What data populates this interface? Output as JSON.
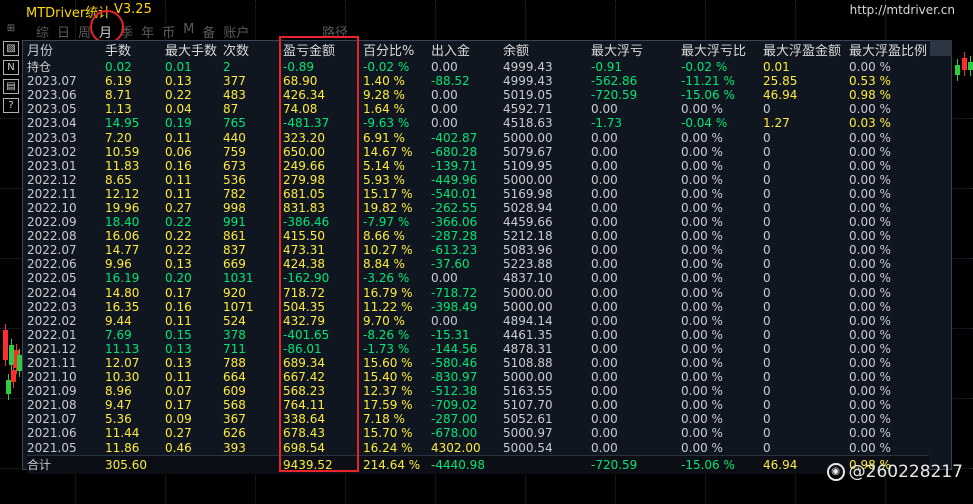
{
  "titlebar": {
    "app": "MTDriver统计",
    "version": "V3.25",
    "site": "http://mtdriver.cn"
  },
  "tools": [
    "⊞",
    "▧",
    "N",
    "▤",
    "?"
  ],
  "tabs": [
    {
      "label": "综",
      "active": false
    },
    {
      "label": "日",
      "active": false
    },
    {
      "label": "周",
      "active": false
    },
    {
      "label": "月",
      "active": true
    },
    {
      "label": "季",
      "active": false
    },
    {
      "label": "年",
      "active": false
    },
    {
      "label": "币",
      "active": false
    },
    {
      "label": "M",
      "active": false
    },
    {
      "label": "备",
      "active": false
    },
    {
      "label": "账户",
      "active": false
    }
  ],
  "tab_extra": "路径",
  "table": {
    "headers": [
      "月份",
      "手数",
      "最大手数",
      "次数",
      "盈亏金额",
      "百分比%",
      "出入金",
      "余额",
      "最大浮亏",
      "最大浮亏比",
      "最大浮盈金额",
      "最大浮盈比例"
    ],
    "rows": [
      [
        "持仓",
        "0.02",
        "0.01",
        "2",
        "-0.89",
        "-0.02 %",
        "0.00",
        "4999.43",
        "-0.91",
        "-0.02 %",
        "0.01",
        "0.00 %"
      ],
      [
        "2023.07",
        "6.19",
        "0.13",
        "377",
        "68.90",
        "1.40 %",
        "-88.52",
        "4999.43",
        "-562.86",
        "-11.21 %",
        "25.85",
        "0.53 %"
      ],
      [
        "2023.06",
        "8.71",
        "0.22",
        "483",
        "426.34",
        "9.28 %",
        "0.00",
        "5019.05",
        "-720.59",
        "-15.06 %",
        "46.94",
        "0.98 %"
      ],
      [
        "2023.05",
        "1.13",
        "0.04",
        "87",
        "74.08",
        "1.64 %",
        "0.00",
        "4592.71",
        "0.00",
        "0.00 %",
        "0",
        "0.00 %"
      ],
      [
        "2023.04",
        "14.95",
        "0.19",
        "765",
        "-481.37",
        "-9.63 %",
        "0.00",
        "4518.63",
        "-1.73",
        "-0.04 %",
        "1.27",
        "0.03 %"
      ],
      [
        "2023.03",
        "7.20",
        "0.11",
        "440",
        "323.20",
        "6.91 %",
        "-402.87",
        "5000.00",
        "0.00",
        "0.00 %",
        "0",
        "0.00 %"
      ],
      [
        "2023.02",
        "10.59",
        "0.06",
        "759",
        "650.00",
        "14.67 %",
        "-680.28",
        "5079.67",
        "0.00",
        "0.00 %",
        "0",
        "0.00 %"
      ],
      [
        "2023.01",
        "11.83",
        "0.16",
        "673",
        "249.66",
        "5.14 %",
        "-139.71",
        "5109.95",
        "0.00",
        "0.00 %",
        "0",
        "0.00 %"
      ],
      [
        "2022.12",
        "8.65",
        "0.11",
        "536",
        "279.98",
        "5.93 %",
        "-449.96",
        "5000.00",
        "0.00",
        "0.00 %",
        "0",
        "0.00 %"
      ],
      [
        "2022.11",
        "12.12",
        "0.11",
        "782",
        "681.05",
        "15.17 %",
        "-540.01",
        "5169.98",
        "0.00",
        "0.00 %",
        "0",
        "0.00 %"
      ],
      [
        "2022.10",
        "19.96",
        "0.27",
        "998",
        "831.83",
        "19.82 %",
        "-262.55",
        "5028.94",
        "0.00",
        "0.00 %",
        "0",
        "0.00 %"
      ],
      [
        "2022.09",
        "18.40",
        "0.22",
        "991",
        "-386.46",
        "-7.97 %",
        "-366.06",
        "4459.66",
        "0.00",
        "0.00 %",
        "0",
        "0.00 %"
      ],
      [
        "2022.08",
        "16.06",
        "0.22",
        "861",
        "415.50",
        "8.66 %",
        "-287.28",
        "5212.18",
        "0.00",
        "0.00 %",
        "0",
        "0.00 %"
      ],
      [
        "2022.07",
        "14.77",
        "0.22",
        "837",
        "473.31",
        "10.27 %",
        "-613.23",
        "5083.96",
        "0.00",
        "0.00 %",
        "0",
        "0.00 %"
      ],
      [
        "2022.06",
        "9.96",
        "0.13",
        "669",
        "424.38",
        "8.84 %",
        "-37.60",
        "5223.88",
        "0.00",
        "0.00 %",
        "0",
        "0.00 %"
      ],
      [
        "2022.05",
        "16.19",
        "0.20",
        "1031",
        "-162.90",
        "-3.26 %",
        "0.00",
        "4837.10",
        "0.00",
        "0.00 %",
        "0",
        "0.00 %"
      ],
      [
        "2022.04",
        "14.80",
        "0.17",
        "920",
        "718.72",
        "16.79 %",
        "-718.72",
        "5000.00",
        "0.00",
        "0.00 %",
        "0",
        "0.00 %"
      ],
      [
        "2022.03",
        "16.35",
        "0.16",
        "1071",
        "504.35",
        "11.22 %",
        "-398.49",
        "5000.00",
        "0.00",
        "0.00 %",
        "0",
        "0.00 %"
      ],
      [
        "2022.02",
        "9.44",
        "0.11",
        "524",
        "432.79",
        "9.70 %",
        "0.00",
        "4894.14",
        "0.00",
        "0.00 %",
        "0",
        "0.00 %"
      ],
      [
        "2022.01",
        "7.69",
        "0.15",
        "378",
        "-401.65",
        "-8.26 %",
        "-15.31",
        "4461.35",
        "0.00",
        "0.00 %",
        "0",
        "0.00 %"
      ],
      [
        "2021.12",
        "11.13",
        "0.13",
        "711",
        "-86.01",
        "-1.73 %",
        "-144.56",
        "4878.31",
        "0.00",
        "0.00 %",
        "0",
        "0.00 %"
      ],
      [
        "2021.11",
        "12.07",
        "0.13",
        "788",
        "689.34",
        "15.60 %",
        "-580.46",
        "5108.88",
        "0.00",
        "0.00 %",
        "0",
        "0.00 %"
      ],
      [
        "2021.10",
        "10.30",
        "0.11",
        "664",
        "667.42",
        "15.40 %",
        "-830.97",
        "5000.00",
        "0.00",
        "0.00 %",
        "0",
        "0.00 %"
      ],
      [
        "2021.09",
        "8.96",
        "0.07",
        "609",
        "568.23",
        "12.37 %",
        "-512.38",
        "5163.55",
        "0.00",
        "0.00 %",
        "0",
        "0.00 %"
      ],
      [
        "2021.08",
        "9.47",
        "0.17",
        "568",
        "764.11",
        "17.59 %",
        "-709.02",
        "5107.70",
        "0.00",
        "0.00 %",
        "0",
        "0.00 %"
      ],
      [
        "2021.07",
        "5.36",
        "0.09",
        "367",
        "338.64",
        "7.18 %",
        "-287.00",
        "5052.61",
        "0.00",
        "0.00 %",
        "0",
        "0.00 %"
      ],
      [
        "2021.06",
        "11.44",
        "0.27",
        "626",
        "678.43",
        "15.70 %",
        "-678.00",
        "5000.97",
        "0.00",
        "0.00 %",
        "0",
        "0.00 %"
      ],
      [
        "2021.05",
        "11.86",
        "0.46",
        "393",
        "698.54",
        "16.24 %",
        "4302.00",
        "5000.54",
        "0.00",
        "0.00 %",
        "0",
        "0.00 %"
      ]
    ],
    "total": [
      "合计",
      "305.60",
      "",
      "",
      "9439.52",
      "214.64 %",
      "-4440.98",
      "",
      "-720.59",
      "-15.06 %",
      "46.94",
      "0.98 %"
    ]
  },
  "colors": {
    "positive": "#ffeb3b",
    "negative": "#00e676",
    "highlight": "#e8232a"
  },
  "watermark": "@260228217"
}
